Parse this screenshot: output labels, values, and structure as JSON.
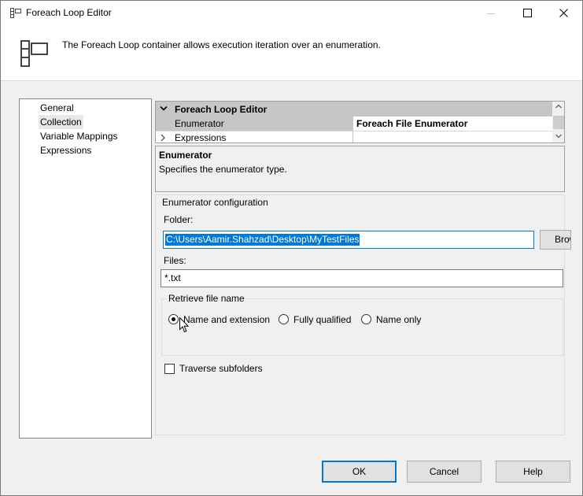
{
  "window": {
    "title": "Foreach Loop Editor"
  },
  "header": {
    "description": "The Foreach Loop container allows execution iteration over an enumeration."
  },
  "nav": {
    "items": [
      {
        "label": "General",
        "selected": false
      },
      {
        "label": "Collection",
        "selected": true
      },
      {
        "label": "Variable Mappings",
        "selected": false
      },
      {
        "label": "Expressions",
        "selected": false
      }
    ]
  },
  "property_grid": {
    "category": "Foreach Loop Editor",
    "rows": [
      {
        "name": "Enumerator",
        "value": "Foreach File Enumerator"
      },
      {
        "name": "Expressions",
        "value": ""
      }
    ]
  },
  "description_panel": {
    "title": "Enumerator",
    "text": "Specifies the enumerator type."
  },
  "config": {
    "title": "Enumerator configuration",
    "folder_label": "Folder:",
    "folder_value": "C:\\Users\\Aamir.Shahzad\\Desktop\\MyTestFiles",
    "browse_label": "Browse...",
    "files_label": "Files:",
    "files_value": "*.txt",
    "retrieve": {
      "title": "Retrieve file name",
      "options": [
        {
          "label": "Name and extension",
          "checked": true
        },
        {
          "label": "Fully qualified",
          "checked": false
        },
        {
          "label": "Name only",
          "checked": false
        }
      ]
    },
    "traverse_label": "Traverse subfolders",
    "traverse_checked": false
  },
  "buttons": {
    "ok": "OK",
    "cancel": "Cancel",
    "help": "Help"
  },
  "colors": {
    "accent": "#0078d7",
    "window_bg": "#f0f0f0",
    "grid_category_bg": "#c6c6c6"
  }
}
